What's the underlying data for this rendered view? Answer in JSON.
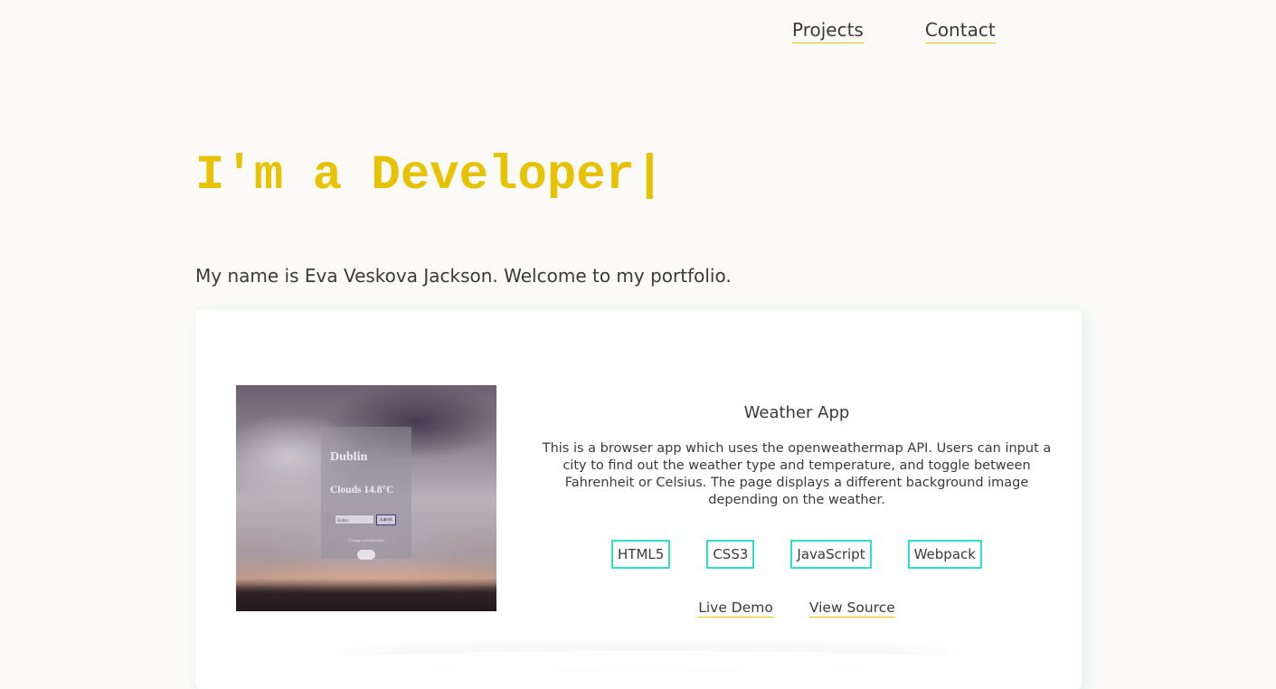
{
  "nav": {
    "projects": "Projects",
    "contact": "Contact"
  },
  "hero": {
    "title": "I'm a Developer|",
    "intro": "My name is Eva Veskova Jackson. Welcome to my portfolio."
  },
  "project": {
    "title": "Weather App",
    "description": "This is a browser app which uses the openweathermap API. Users can input a city to find out the weather type and temperature, and toggle between Fahrenheit or Celsius. The page displays a different background image depending on the weather.",
    "tags": [
      "HTML5",
      "CSS3",
      "JavaScript",
      "Webpack"
    ],
    "live_demo": "Live Demo",
    "view_source": "View Source",
    "screenshot": {
      "city": "Dublin",
      "weather": "Clouds 14.8°C",
      "input_value": "Dublin",
      "button": "submit",
      "toggle_label": "Change to Fahrenheit"
    }
  },
  "colors": {
    "accent": "#e6c200",
    "tag_border": "#2ee0c8",
    "background": "#fbfaf8",
    "text": "#3a3a3a"
  }
}
